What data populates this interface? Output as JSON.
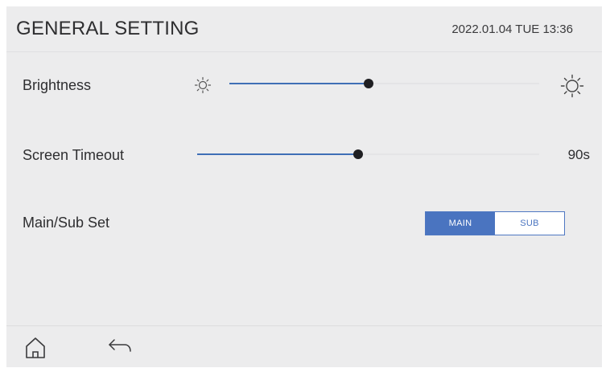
{
  "header": {
    "title": "GENERAL SETTING",
    "datetime": "2022.01.04 TUE 13:36"
  },
  "brightness": {
    "label": "Brightness",
    "level": 0.45,
    "min_icon": "sun-small-icon",
    "max_icon": "sun-large-icon"
  },
  "screen_timeout": {
    "label": "Screen Timeout",
    "level": 0.47,
    "value": "90s"
  },
  "main_sub_set": {
    "label": "Main/Sub Set",
    "options": [
      "MAIN",
      "SUB"
    ],
    "selected": "MAIN"
  },
  "footer": {
    "home_icon": "home-icon",
    "back_icon": "back-arrow-icon"
  },
  "colors": {
    "accent": "#4a74c0",
    "slider_fill": "#3f6fb6",
    "knob": "#1f1f22",
    "background": "#ececed"
  }
}
